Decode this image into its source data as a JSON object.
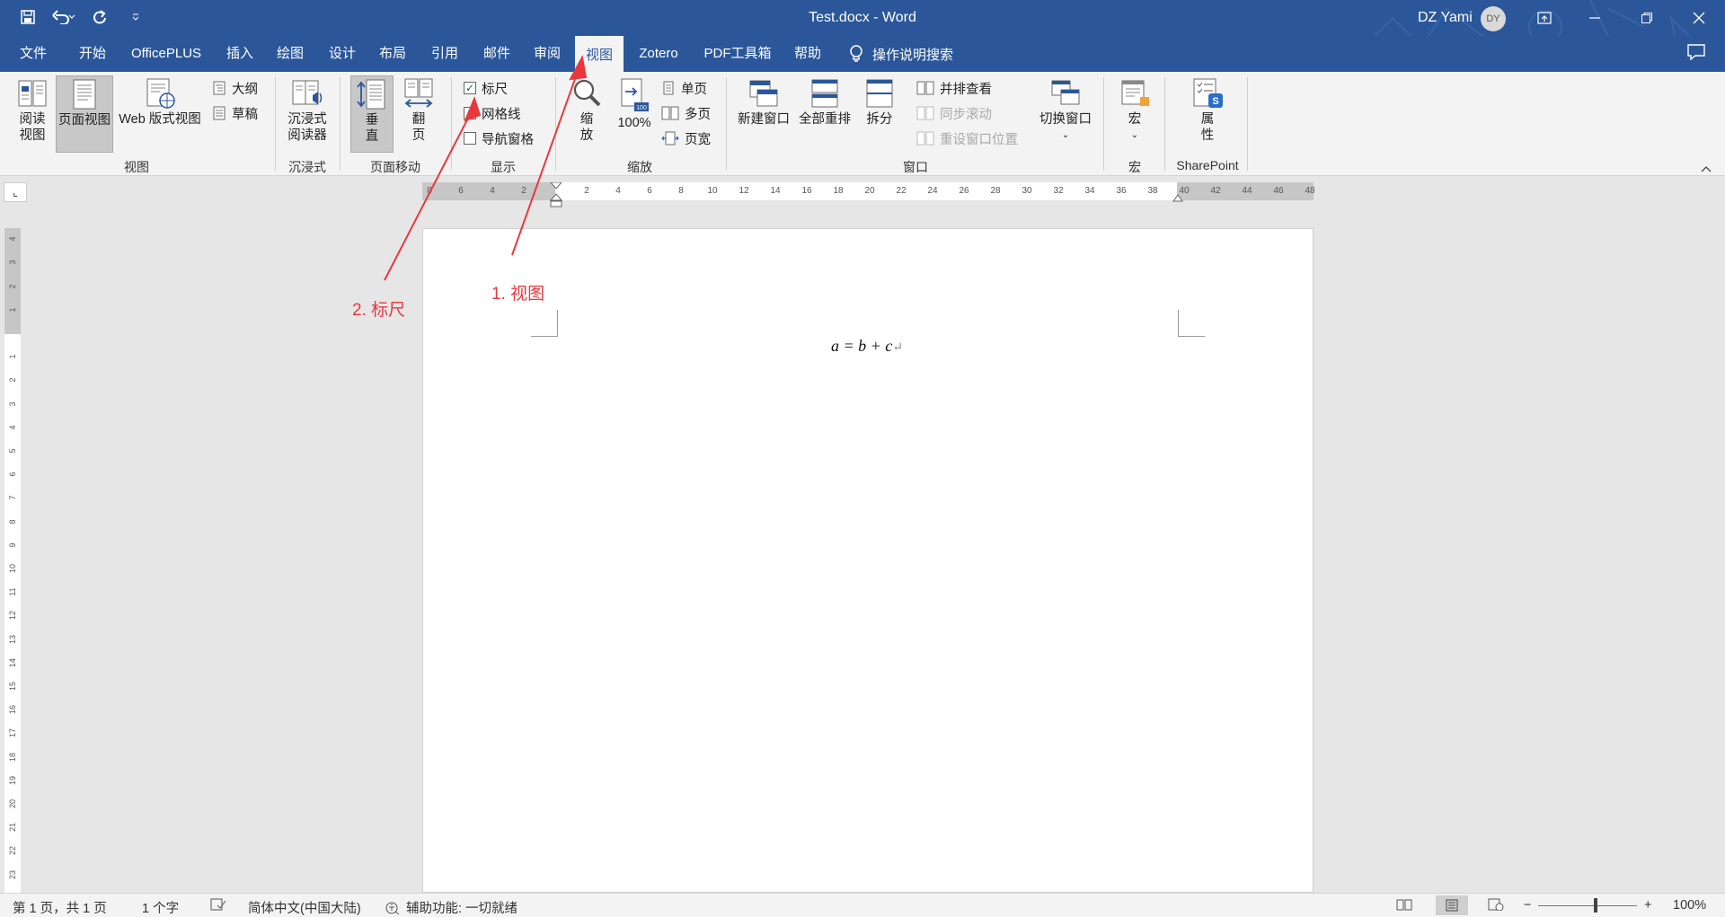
{
  "window": {
    "title": "Test.docx  -  Word",
    "user_name": "DZ Yami",
    "user_initials": "DY"
  },
  "tabs": [
    {
      "label": "文件"
    },
    {
      "label": "开始"
    },
    {
      "label": "OfficePLUS"
    },
    {
      "label": "插入"
    },
    {
      "label": "绘图"
    },
    {
      "label": "设计"
    },
    {
      "label": "布局"
    },
    {
      "label": "引用"
    },
    {
      "label": "邮件"
    },
    {
      "label": "审阅"
    },
    {
      "label": "视图",
      "active": true
    },
    {
      "label": "Zotero"
    },
    {
      "label": "PDF工具箱"
    },
    {
      "label": "帮助"
    }
  ],
  "tell_me": "操作说明搜索",
  "ribbon": {
    "views": {
      "read_mode": "阅读\n视图",
      "print_layout": "页面视图",
      "web_layout": "Web 版式视图",
      "outline": "大纲",
      "draft": "草稿",
      "group": "视图"
    },
    "immersive": {
      "reader": "沉浸式\n阅读器",
      "group": "沉浸式"
    },
    "page_movement": {
      "vertical": "垂\n直",
      "side_to_side": "翻\n页",
      "group": "页面移动"
    },
    "show": {
      "ruler": "标尺",
      "ruler_checked": true,
      "gridlines": "网格线",
      "gridlines_checked": false,
      "nav_pane": "导航窗格",
      "nav_pane_checked": false,
      "group": "显示"
    },
    "zoom": {
      "zoom": "缩\n放",
      "hundred": "100%",
      "one_page": "单页",
      "multi_page": "多页",
      "page_width": "页宽",
      "group": "缩放"
    },
    "window": {
      "new_window": "新建窗口",
      "arrange_all": "全部重排",
      "split": "拆分",
      "side_by_side": "并排查看",
      "sync_scroll": "同步滚动",
      "reset_position": "重设窗口位置",
      "switch_windows": "切换窗口",
      "group": "窗口"
    },
    "macros": {
      "macros": "宏",
      "group": "宏"
    },
    "sharepoint": {
      "properties": "属\n性",
      "group": "SharePoint"
    }
  },
  "ruler": {
    "left_ticks": [
      "8",
      "6",
      "4",
      "2"
    ],
    "ticks": [
      "2",
      "4",
      "6",
      "8",
      "10",
      "12",
      "14",
      "16",
      "18",
      "20",
      "22",
      "24",
      "26",
      "28",
      "30",
      "32",
      "34",
      "36",
      "38"
    ],
    "right_ticks": [
      "40",
      "42",
      "44",
      "46",
      "48"
    ],
    "vertical_top_ticks": [
      "4",
      "3",
      "2",
      "1"
    ],
    "vertical_ticks": [
      "1",
      "2",
      "3",
      "4",
      "5",
      "6",
      "7",
      "8",
      "9",
      "10",
      "11",
      "12",
      "13",
      "14",
      "15",
      "16",
      "17",
      "18",
      "19",
      "20",
      "21",
      "22",
      "23"
    ]
  },
  "document": {
    "formula": "a = b + c",
    "paragraph_mark": "↵"
  },
  "annotations": {
    "step1": "1. 视图",
    "step2": "2. 标尺",
    "color": "#e8383d"
  },
  "statusbar": {
    "page": "第 1 页，共 1 页",
    "words": "1 个字",
    "language": "简体中文(中国大陆)",
    "accessibility": "辅助功能: 一切就绪",
    "zoom": "100%"
  },
  "colors": {
    "brand": "#2b579a",
    "ribbon_bg": "#f3f3f3"
  }
}
